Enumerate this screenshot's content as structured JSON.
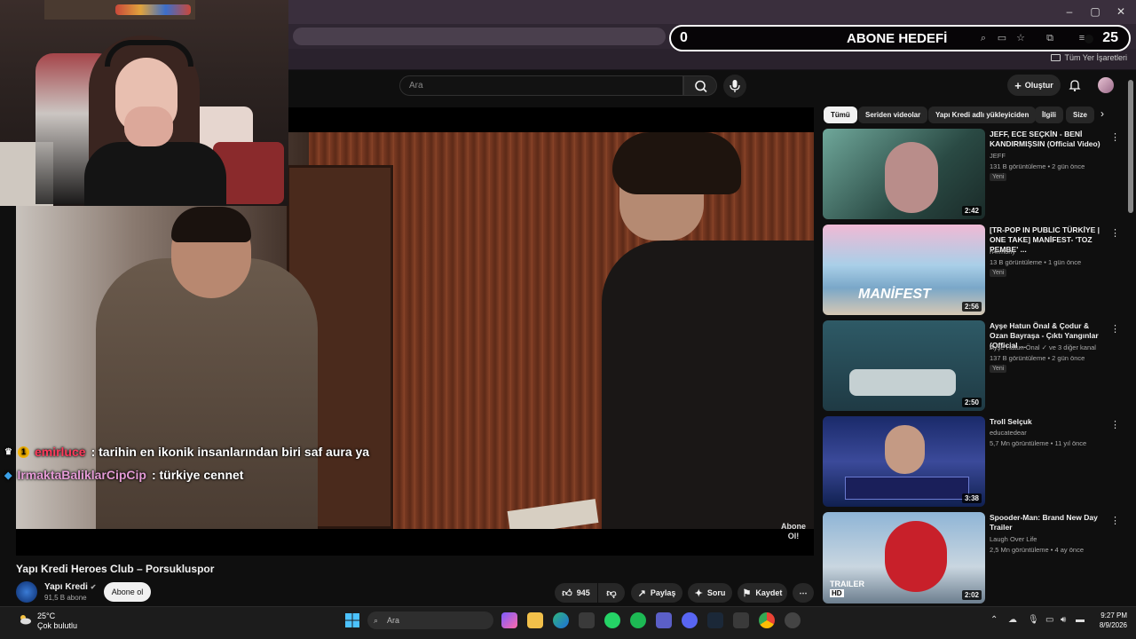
{
  "browser": {
    "window_controls": {
      "minimize": "–",
      "maximize": "▢",
      "close": "✕"
    },
    "bookmarks_all": "Tüm Yer İşaretleri"
  },
  "sub_goal": {
    "current": "0",
    "label": "ABONE HEDEFİ",
    "target": "25"
  },
  "header": {
    "search_placeholder": "Ara",
    "create_label": "Oluştur"
  },
  "video": {
    "title": "Yapı Kredi Heroes Club – Porsukluspor",
    "watermark_line1": "Abone",
    "watermark_line2": "Ol!"
  },
  "chat": [
    {
      "user": "emirluce",
      "message": ": tarihin en ikonik insanlarından biri saf aura ya"
    },
    {
      "user": "IrmaktaBaliklarCipCip",
      "message": ": türkiye cennet"
    }
  ],
  "channel": {
    "name": "Yapı Kredi",
    "subs": "91,5 B abone",
    "subscribe_label": "Abone ol"
  },
  "actions": {
    "likes": "945",
    "share": "Paylaş",
    "ask": "Soru",
    "save": "Kaydet",
    "more": "⋯"
  },
  "chips": [
    "Tümü",
    "Seriden videolar",
    "Yapı Kredi adlı yükleyiciden",
    "İlgili",
    "Size"
  ],
  "recommendations": [
    {
      "title": "JEFF, ECE SEÇKİN - BENİ KANDIRMIŞSIN (Official Video)",
      "channel": "JEFF",
      "meta": "131 B görüntüleme • 2 gün önce",
      "badge": "Yeni",
      "duration": "2:42"
    },
    {
      "title": "[TR-POP IN PUBLIC TÜRKİYE | ONE TAKE] MANİFEST- 'TOZ PEMBE' ...",
      "channel": "h4rmony",
      "meta": "13 B görüntüleme • 1 gün önce",
      "badge": "Yeni",
      "duration": "2:56"
    },
    {
      "title": "Ayşe Hatun Önal & Çodur & Ozan Bayraşa - Çıktı Yangınlar (Official ...",
      "channel": "Ayşe Hatun Önal ✓ ve 3 diğer kanal",
      "meta": "137 B görüntüleme • 2 gün önce",
      "badge": "Yeni",
      "duration": "2:50"
    },
    {
      "title": "Troll Selçuk",
      "channel": "educatedear",
      "meta": "5,7 Mn görüntüleme • 11 yıl önce",
      "badge": "",
      "duration": "3:38"
    },
    {
      "title": "Spooder-Man: Brand New Day Trailer",
      "channel": "Laugh Over Life",
      "meta": "2,5 Mn görüntüleme • 4 ay önce",
      "badge": "",
      "duration": "2:02",
      "thumb_text1": "TRAILER",
      "thumb_text2": "HD"
    }
  ],
  "thumb_text": {
    "manifest": "MANİFEST"
  },
  "taskbar": {
    "weather_temp": "25°C",
    "weather_desc": "Çok bulutlu",
    "search_placeholder": "Ara",
    "time": "9:27 PM",
    "date": "8/9/2026"
  },
  "colors": {
    "user1": "#ff3b5c",
    "user2": "#e59bd6",
    "accent": "#f1f1f1"
  }
}
